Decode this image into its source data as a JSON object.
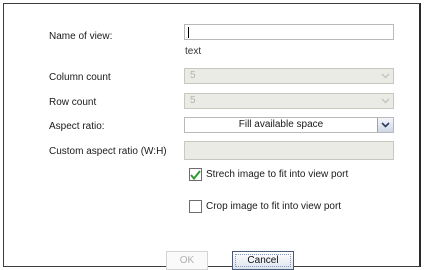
{
  "form": {
    "name_label": "Name of view:",
    "name_value": "",
    "name_hint": "text",
    "column_label": "Column count",
    "column_value": "5",
    "row_label": "Row count",
    "row_value": "5",
    "aspect_label": "Aspect ratio:",
    "aspect_value": "Fill available space",
    "custom_label": "Custom aspect ratio (W:H)",
    "custom_value": "",
    "stretch_label": "Strech image to fit into view port",
    "stretch_checked": true,
    "crop_label": "Crop image to fit into view port",
    "crop_checked": false
  },
  "buttons": {
    "ok": "OK",
    "cancel": "Cancel"
  },
  "colors": {
    "check": "#2f9a2f",
    "disabled_bg": "#ebebe5",
    "border": "#b9b9b9"
  },
  "icons": {
    "dropdown": "chevron-down-icon",
    "checkmark": "checkmark-icon"
  }
}
